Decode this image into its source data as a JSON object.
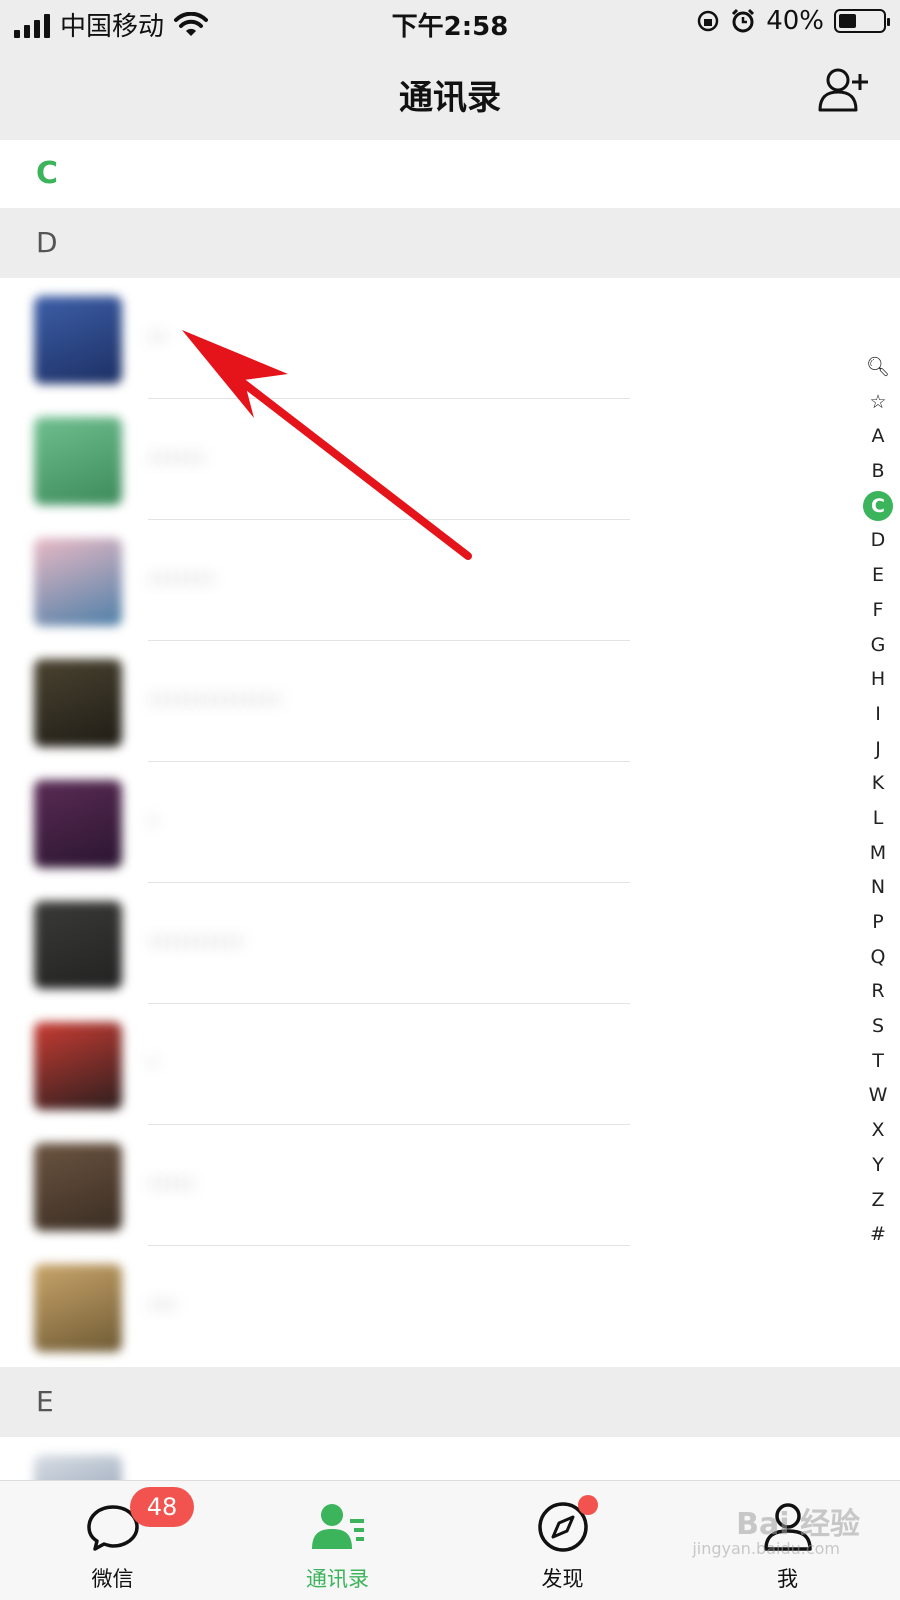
{
  "status_bar": {
    "carrier": "中国移动",
    "time": "下午2:58",
    "battery_percent": "40%",
    "battery_level": 0.4
  },
  "nav": {
    "title": "通讯录",
    "add_icon": "add-contact-icon"
  },
  "sections": {
    "c_label": "C",
    "d_label": "D",
    "e_label": "E"
  },
  "contacts": [
    {
      "name": "··"
    },
    {
      "name": "······"
    },
    {
      "name": "·······"
    },
    {
      "name": "··············"
    },
    {
      "name": "·"
    },
    {
      "name": "··········"
    },
    {
      "name": "·"
    },
    {
      "name": "·····"
    },
    {
      "name": "···"
    }
  ],
  "index_letters": [
    "🔍︎",
    "☆",
    "A",
    "B",
    "C",
    "D",
    "E",
    "F",
    "G",
    "H",
    "I",
    "J",
    "K",
    "L",
    "M",
    "N",
    "P",
    "Q",
    "R",
    "S",
    "T",
    "W",
    "X",
    "Y",
    "Z",
    "#"
  ],
  "index_active": "C",
  "tabs": [
    {
      "label": "微信",
      "icon": "chat-bubble-icon",
      "badge": "48"
    },
    {
      "label": "通讯录",
      "icon": "contacts-icon"
    },
    {
      "label": "发现",
      "icon": "compass-icon"
    },
    {
      "label": "我",
      "icon": "profile-icon"
    }
  ],
  "watermark": {
    "text": "Bai 经验",
    "sub": "jingyan.baidu.com"
  },
  "colors": {
    "accent": "#3bb45b",
    "badge": "#f2534f",
    "arrow": "#e5141b"
  }
}
